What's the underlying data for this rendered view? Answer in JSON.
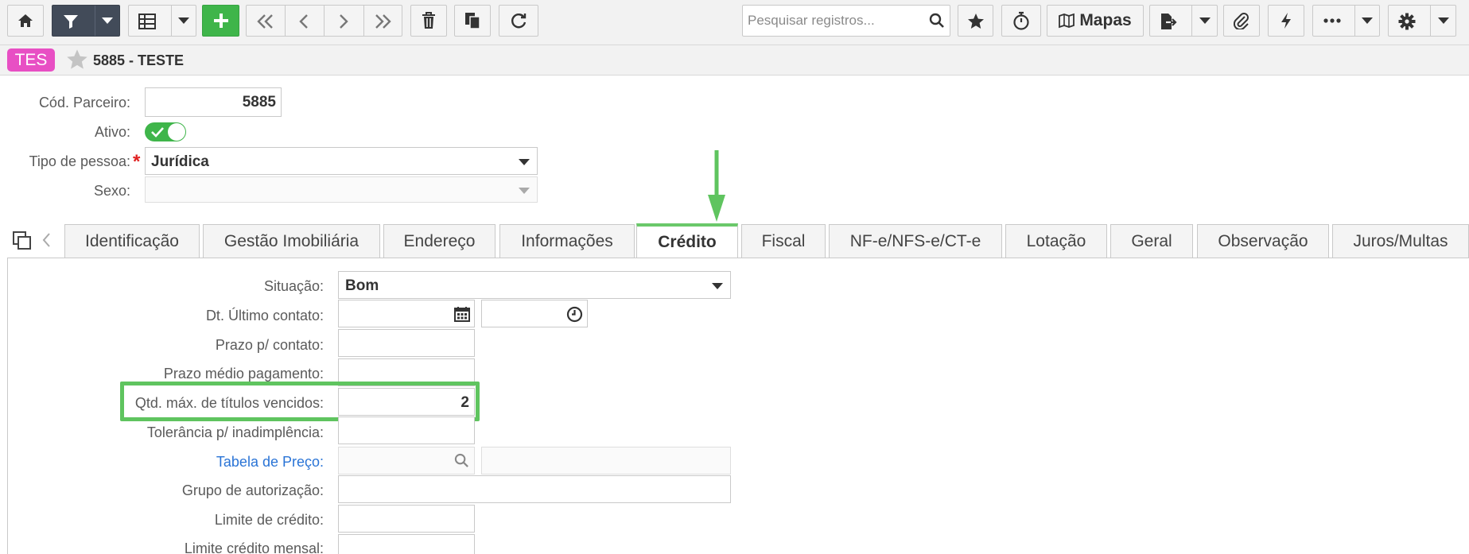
{
  "toolbar": {
    "search_placeholder": "Pesquisar registros...",
    "mapas_label": "Mapas"
  },
  "titlebar": {
    "badge": "TES",
    "title": "5885 - TESTE"
  },
  "header": {
    "cod_parceiro_label": "Cód. Parceiro:",
    "cod_parceiro_value": "5885",
    "ativo_label": "Ativo:",
    "ativo_checked": true,
    "tipo_pessoa_label": "Tipo de pessoa:",
    "tipo_pessoa_value": "Jurídica",
    "sexo_label": "Sexo:",
    "sexo_value": ""
  },
  "tabs": [
    {
      "label": "Identificação"
    },
    {
      "label": "Gestão Imobiliária"
    },
    {
      "label": "Endereço"
    },
    {
      "label": "Informações"
    },
    {
      "label": "Crédito",
      "active": true
    },
    {
      "label": "Fiscal"
    },
    {
      "label": "NF-e/NFS-e/CT-e"
    },
    {
      "label": "Lotação"
    },
    {
      "label": "Geral"
    },
    {
      "label": "Observação"
    },
    {
      "label": "Juros/Multas"
    }
  ],
  "credito": {
    "situacao_label": "Situação:",
    "situacao_value": "Bom",
    "dt_ultimo_contato_label": "Dt. Último contato:",
    "dt_ultimo_contato_date": "",
    "dt_ultimo_contato_time": "",
    "prazo_contato_label": "Prazo p/ contato:",
    "prazo_contato_value": "",
    "prazo_medio_label": "Prazo médio pagamento:",
    "prazo_medio_value": "",
    "qtd_max_label": "Qtd. máx. de títulos vencidos:",
    "qtd_max_value": "2",
    "tolerancia_label": "Tolerância p/ inadimplência:",
    "tolerancia_value": "",
    "tabela_preco_label": "Tabela de Preço:",
    "tabela_preco_code": "",
    "tabela_preco_desc": "",
    "grupo_autorizacao_label": "Grupo de autorização:",
    "grupo_autorizacao_value": "",
    "limite_credito_label": "Limite de crédito:",
    "limite_credito_value": "",
    "limite_mensal_label": "Limite crédito mensal:",
    "limite_mensal_value": ""
  },
  "colors": {
    "accent_green": "#3fb54a",
    "highlight_green": "#5fc45f",
    "badge_pink": "#e84fc4",
    "link_blue": "#2a74d6",
    "required_red": "#e02020"
  }
}
